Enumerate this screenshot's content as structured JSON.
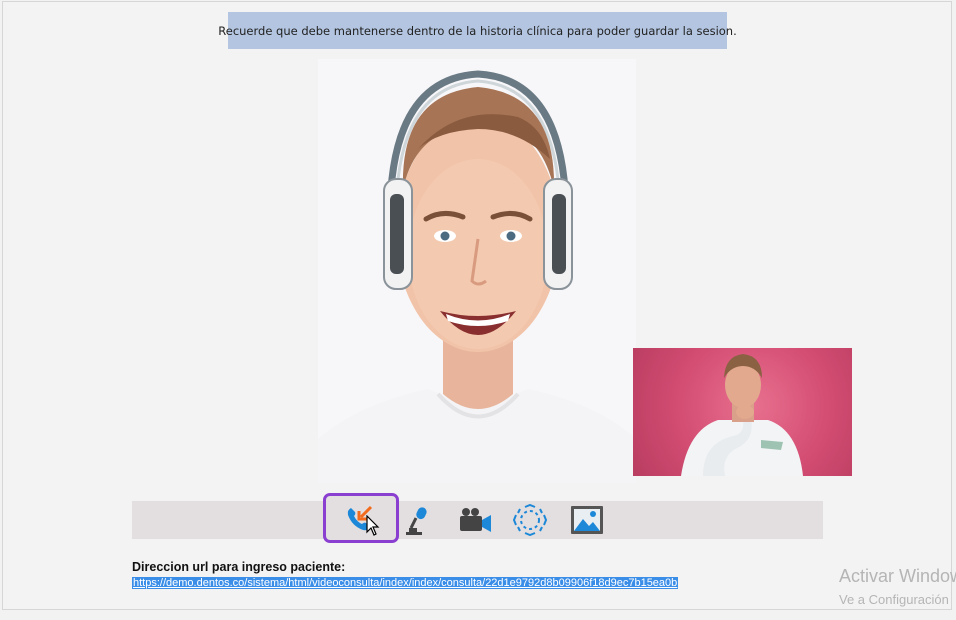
{
  "notice": {
    "text": "Recuerde que debe mantenerse dentro de la historia clínica para poder guardar la sesion."
  },
  "toolbar": {
    "buttons": [
      {
        "icon": "phone-hangup-icon"
      },
      {
        "icon": "microphone-icon"
      },
      {
        "icon": "video-camera-icon"
      },
      {
        "icon": "fullscreen-icon"
      },
      {
        "icon": "picture-icon"
      }
    ],
    "accent_color": "#8a3fd0",
    "icon_blue": "#1e88d8"
  },
  "patient_url": {
    "label": "Direccion url para ingreso paciente:",
    "url": "https://demo.dentos.co/sistema/html/videoconsulta/index/index/consulta/22d1e9792d8b09906f18d9ec7b15ea0b"
  },
  "watermark": {
    "line1": "Activar Windows",
    "line2": "Ve a Configuración"
  }
}
